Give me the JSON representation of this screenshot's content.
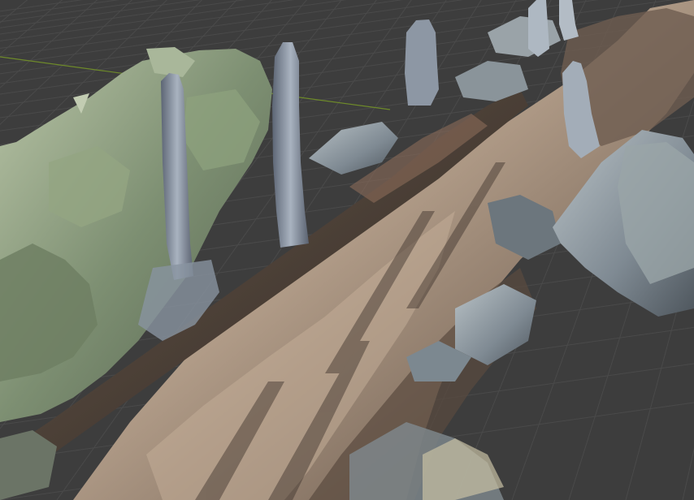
{
  "viewport": {
    "background_color": "#3d3d3d",
    "grid_color": "#4a4a4a",
    "x_axis_color": "#8b3a3a",
    "y_axis_color": "#6e8a2a",
    "scene": "photogrammetry-mesh-forest-trail"
  },
  "mesh_colors": {
    "dirt_path": "#a48f7c",
    "dirt_shadow": "#4f4036",
    "log": "#3a302a",
    "foliage_light": "#9fb08c",
    "foliage_dark": "#5d6b55",
    "rock": "#8e98a0",
    "tree_trunk": "#7c8796"
  }
}
